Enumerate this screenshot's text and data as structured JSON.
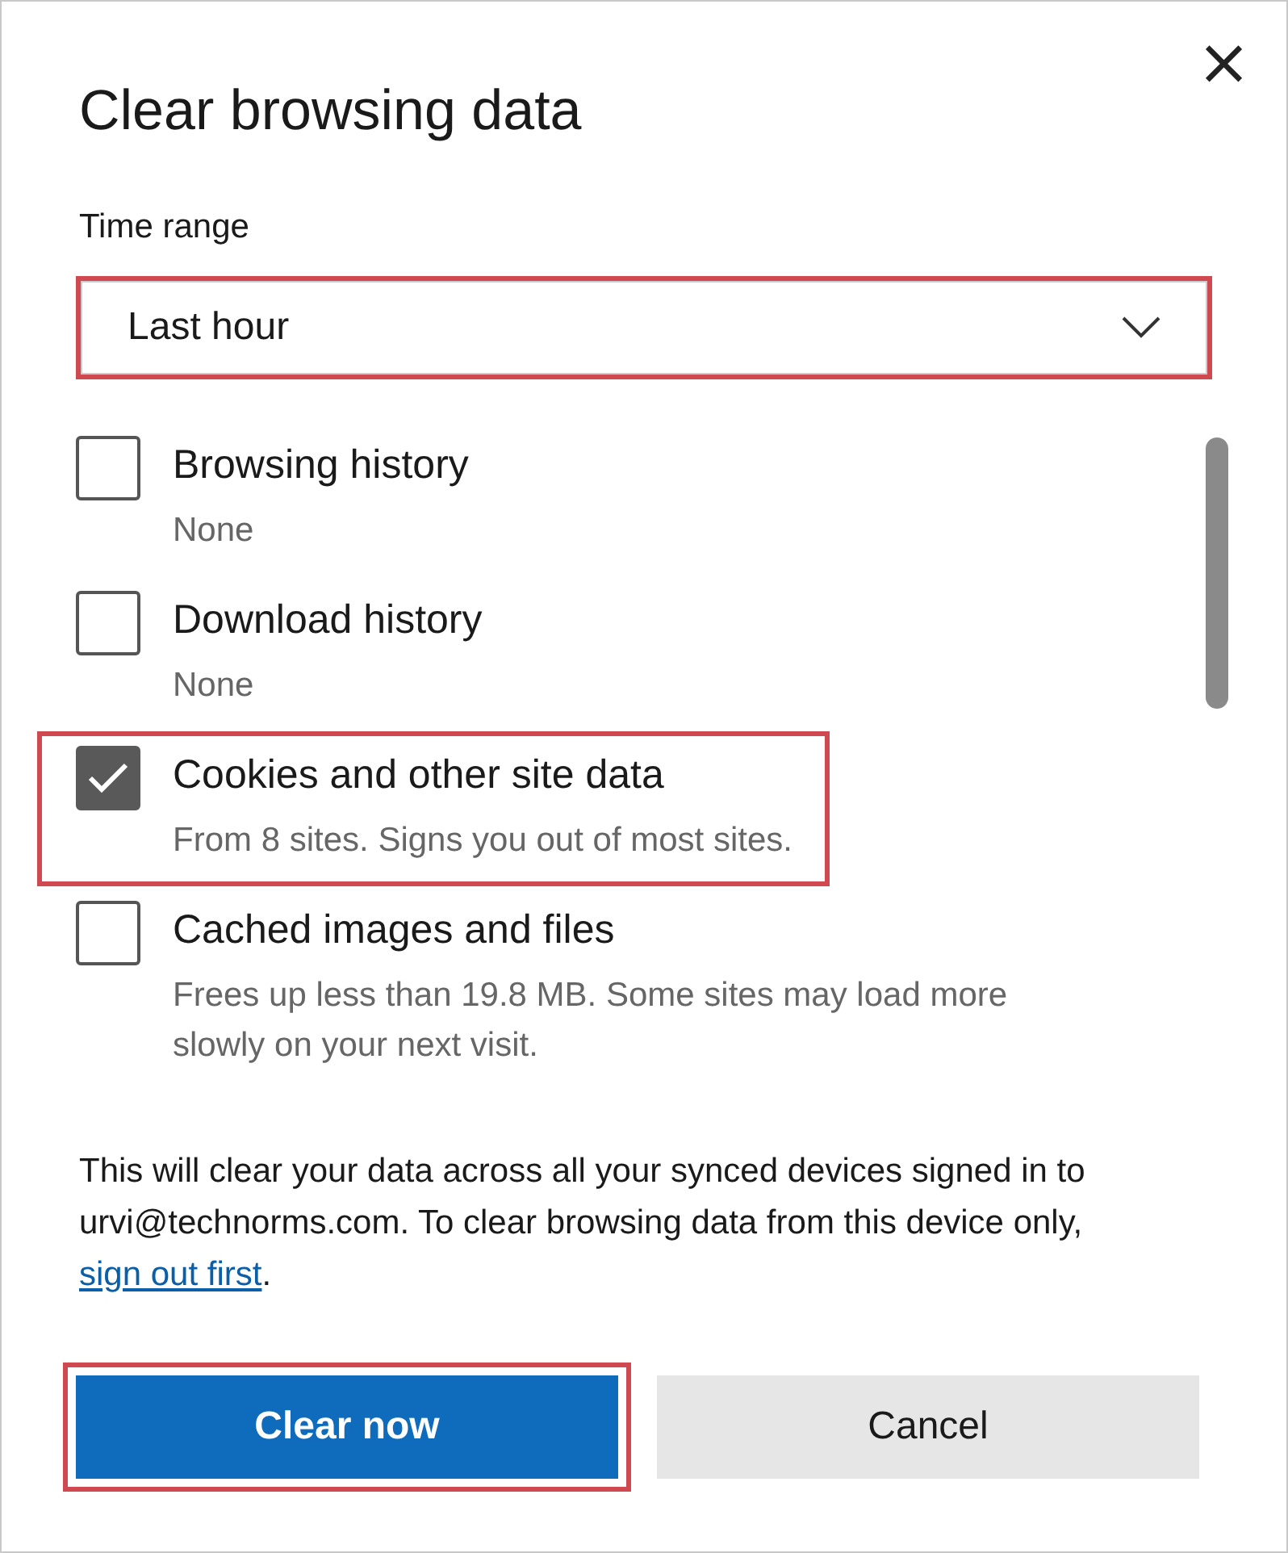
{
  "dialog": {
    "title": "Clear browsing data",
    "close": "×"
  },
  "time_range": {
    "label": "Time range",
    "value": "Last hour",
    "highlighted": true
  },
  "items": [
    {
      "label": "Browsing history",
      "detail": "None",
      "checked": false,
      "highlighted": false
    },
    {
      "label": "Download history",
      "detail": "None",
      "checked": false,
      "highlighted": false
    },
    {
      "label": "Cookies and other site data",
      "detail": "From 8 sites. Signs you out of most sites.",
      "checked": true,
      "highlighted": true
    },
    {
      "label": "Cached images and files",
      "detail": "Frees up less than 19.8 MB. Some sites may load more slowly on your next visit.",
      "checked": false,
      "highlighted": false
    }
  ],
  "notice": {
    "text": "This will clear your data across all your synced devices signed in to urvi@technorms.com. To clear browsing data from this device only, ",
    "link": "sign out first",
    "end": "."
  },
  "buttons": [
    {
      "label": "Clear now",
      "kind": "primary",
      "highlighted": true
    },
    {
      "label": "Cancel",
      "kind": "secondary",
      "highlighted": false
    }
  ]
}
